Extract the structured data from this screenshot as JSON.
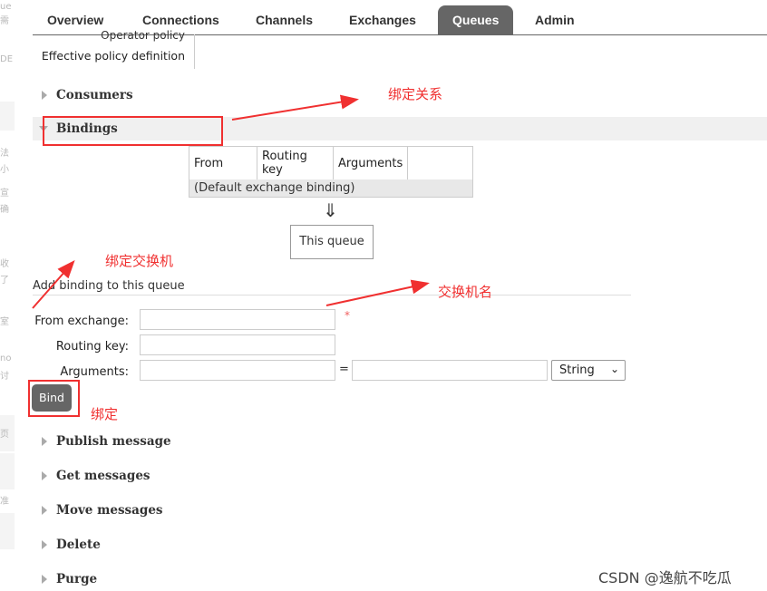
{
  "left_strip": [
    "ue",
    "需",
    "DE",
    "法",
    "小",
    "宣",
    "确",
    "收",
    "了",
    "室",
    "no",
    "讨",
    "页",
    "准"
  ],
  "nav": {
    "tabs": [
      {
        "label": "Overview",
        "active": false
      },
      {
        "label": "Connections",
        "active": false
      },
      {
        "label": "Channels",
        "active": false
      },
      {
        "label": "Exchanges",
        "active": false
      },
      {
        "label": "Queues",
        "active": true
      },
      {
        "label": "Admin",
        "active": false
      }
    ]
  },
  "policy": {
    "operator_label": "Operator policy",
    "effective_label": "Effective policy definition"
  },
  "sections": {
    "consumers": "Consumers",
    "bindings": "Bindings",
    "publish": "Publish message",
    "get": "Get messages",
    "move": "Move messages",
    "delete": "Delete",
    "purge": "Purge"
  },
  "bindings_table": {
    "headers": [
      "From",
      "Routing key",
      "Arguments"
    ],
    "default_row": "(Default exchange binding)"
  },
  "arrow_glyph": "⇓",
  "this_queue": "This queue",
  "add_binding": {
    "title": "Add binding to this queue",
    "from_exchange_label": "From exchange:",
    "routing_key_label": "Routing key:",
    "arguments_label": "Arguments:",
    "required_mark": "*",
    "equals": "=",
    "type_select": "String",
    "bind_button": "Bind"
  },
  "annotations": {
    "bind_relation": "绑定关系",
    "bind_exchange": "绑定交换机",
    "exchange_name": "交换机名",
    "bind": "绑定",
    "color": "#f03030"
  },
  "watermark": "CSDN @逸航不吃瓜",
  "colors": {
    "active_tab_bg": "#666666",
    "button_bg": "#666666",
    "annotation_red": "#f03030"
  }
}
